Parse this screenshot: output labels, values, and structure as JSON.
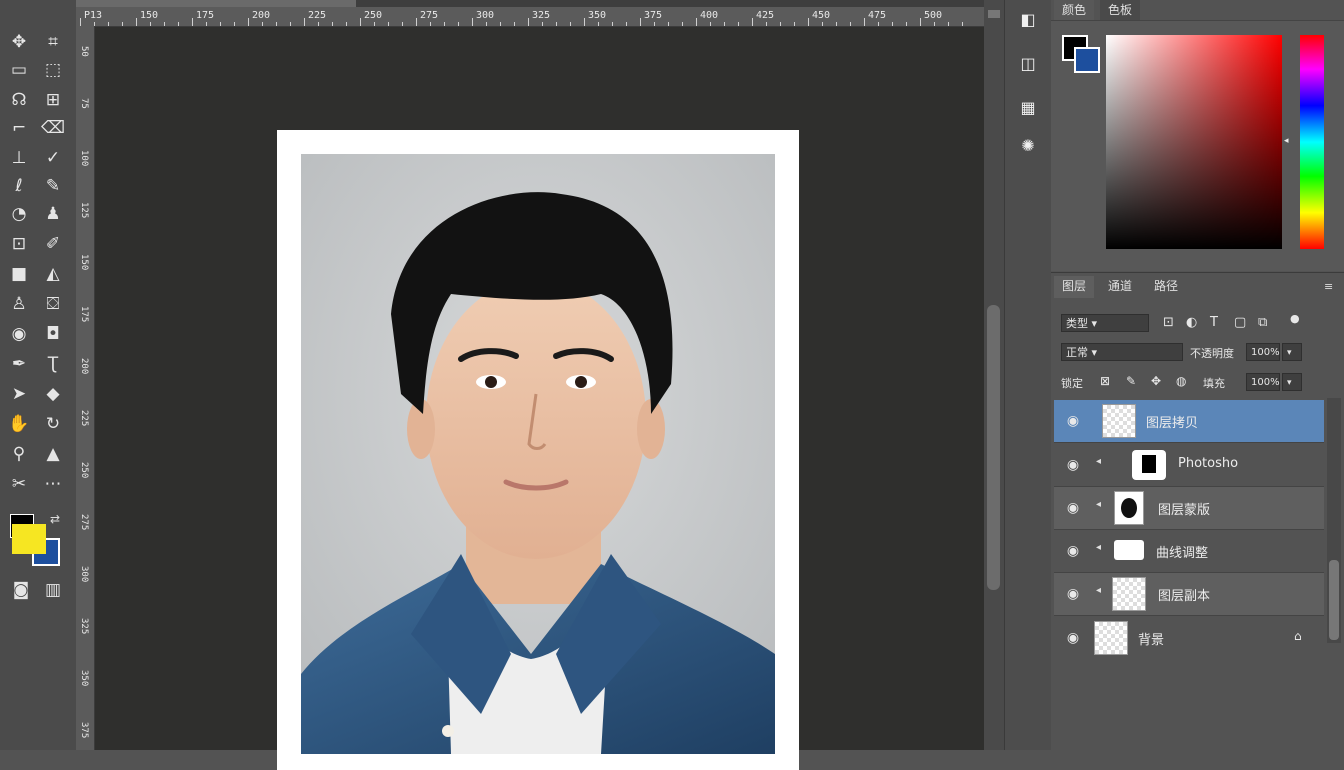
{
  "app": {
    "name": "Photoshop"
  },
  "toolbar": {
    "tools": [
      "move-tool",
      "artboard-tool",
      "marquee-tool",
      "lasso-tool",
      "quick-select-tool",
      "crop-tool",
      "frame-tool",
      "eyedropper-tool",
      "spot-heal-tool",
      "brush-tool",
      "clone-stamp-tool",
      "history-brush-tool",
      "eraser-tool",
      "gradient-tool",
      "blur-tool",
      "dodge-tool",
      "pen-tool",
      "type-tool",
      "path-select-tool",
      "shape-tool",
      "hand-tool",
      "zoom-tool",
      "rotate-view-tool",
      "edit-toolbar-tool"
    ],
    "foreground_color": "#000000",
    "swatch_color": "#f6e622",
    "background_color": "#1d4f9e"
  },
  "ruler": {
    "h_labels": [
      "P13",
      "150",
      "175",
      "200",
      "225",
      "250",
      "275",
      "300",
      "325",
      "350",
      "375",
      "400",
      "425",
      "450",
      "475",
      "500"
    ],
    "v_labels": [
      "50",
      "75",
      "100",
      "125",
      "150",
      "175",
      "200",
      "225",
      "250",
      "275",
      "300",
      "325",
      "350",
      "375"
    ]
  },
  "color_panel": {
    "tabs": [
      "颜色",
      "色板"
    ],
    "foreground": "#000000",
    "background": "#1d4f9e"
  },
  "layers_panel": {
    "tabs": [
      "图层",
      "通道",
      "路径"
    ],
    "filter_label": "类型",
    "blend_mode": "正常",
    "opacity_label": "不透明度",
    "opacity_value": "100%",
    "lock_label": "锁定",
    "fill_label": "填充",
    "fill_value": "100%",
    "layers": [
      {
        "name": "图层拷贝",
        "selected": true,
        "visible": true
      },
      {
        "name": "Photosho",
        "selected": false,
        "visible": true
      },
      {
        "name": "图层蒙版",
        "selected": false,
        "visible": true
      },
      {
        "name": "曲线调整",
        "selected": false,
        "visible": true
      },
      {
        "name": "图层副本",
        "selected": false,
        "visible": true
      },
      {
        "name": "背景",
        "selected": false,
        "visible": true,
        "locked": true
      }
    ]
  }
}
